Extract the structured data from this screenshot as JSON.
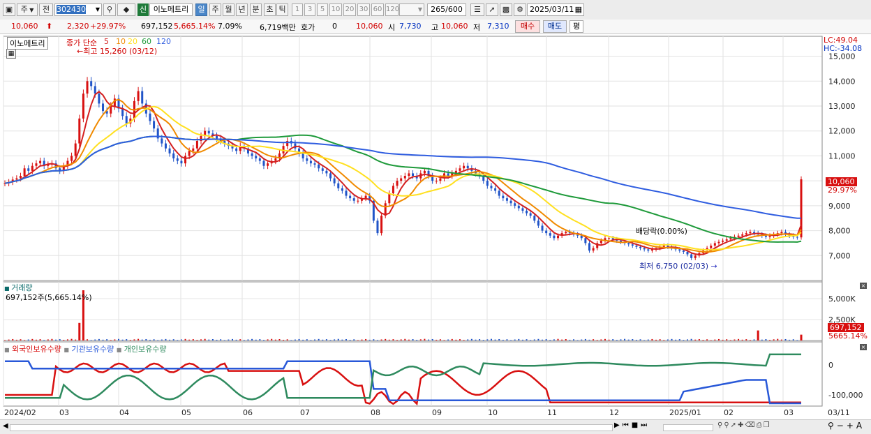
{
  "toolbar": {
    "type_label": "주",
    "prev_label": "전",
    "code": "302430",
    "credit_badge": "신",
    "stock_name": "이노메트리",
    "periods": [
      "일",
      "주",
      "월",
      "년",
      "분",
      "초",
      "틱"
    ],
    "active_period": "일",
    "intervals": [
      "1",
      "3",
      "5",
      "10",
      "20",
      "30",
      "60",
      "120"
    ],
    "count": "265",
    "count_max": "/600",
    "date": "2025/03/11"
  },
  "quote": {
    "price": "10,060",
    "change": "2,320",
    "change_pct": "+29.97%",
    "volume": "697,152",
    "volume_pct": "5,665.14%",
    "turnover": "7.09%",
    "amount": "6,719백만",
    "hoga_label": "호가",
    "hoga_value": "0",
    "ask": "10,060",
    "open_label": "시",
    "open": "7,730",
    "high_label": "고",
    "high": "10,060",
    "low_label": "저",
    "low": "7,310",
    "buy_label": "매수",
    "sell_label": "매도",
    "eval_label": "평"
  },
  "price_panel": {
    "title": "이노메트리",
    "legend_prefix": "종가 단순",
    "ma_periods": [
      "5",
      "10",
      "20",
      "60",
      "120"
    ],
    "ma_colors": [
      "#d42020",
      "#f08a00",
      "#ffe020",
      "#1e9a3a",
      "#2f5de0"
    ],
    "lc": "LC:49.04",
    "hc": "HC:-34.08",
    "high_note": "최고 15,260 (03/12)",
    "low_note": "최저 6,750 (02/03)",
    "dividend_note": "배당락(0.00%)",
    "current_tag": "10,060",
    "current_pct": "29.97%"
  },
  "volume_panel": {
    "title": "거래량",
    "value": "697,152주(5,665.14%)",
    "tag_value": "697,152",
    "tag_pct": "5665.14%"
  },
  "holdings_panel": {
    "series": [
      {
        "name": "외국인보유수량",
        "color": "#d81010"
      },
      {
        "name": "기관보유수량",
        "color": "#2858d8"
      },
      {
        "name": "개인보유수량",
        "color": "#2e8a5e"
      }
    ]
  },
  "x_axis": {
    "labels": [
      "2024/02",
      "03",
      "04",
      "05",
      "06",
      "07",
      "08",
      "09",
      "10",
      "11",
      "12",
      "2025/01",
      "02",
      "03"
    ],
    "right_label": "03/11"
  },
  "chart_data": [
    {
      "type": "candlestick",
      "title": "이노메트리",
      "y_ticks": [
        7000,
        8000,
        9000,
        10000,
        11000,
        12000,
        13000,
        14000,
        15000
      ],
      "ylim": [
        6000,
        15800
      ],
      "closes": [
        9900,
        9950,
        10050,
        10100,
        10200,
        10500,
        10400,
        10600,
        10700,
        10800,
        10600,
        10650,
        10700,
        10500,
        10400,
        10600,
        10800,
        11000,
        11500,
        12500,
        13500,
        14000,
        13800,
        13500,
        13100,
        12800,
        12700,
        13000,
        13300,
        12900,
        12600,
        12300,
        12500,
        13200,
        13600,
        13100,
        12700,
        12400,
        12100,
        11700,
        11500,
        11300,
        11100,
        10900,
        10800,
        10700,
        11000,
        11200,
        11300,
        11600,
        11800,
        12000,
        11900,
        11800,
        11700,
        11600,
        11500,
        11400,
        11300,
        11200,
        11400,
        11300,
        11100,
        11000,
        10900,
        10800,
        10600,
        10700,
        10800,
        10900,
        11100,
        11400,
        11600,
        11500,
        11300,
        11100,
        10900,
        10800,
        10700,
        10650,
        10500,
        10400,
        10300,
        10100,
        9900,
        9700,
        9600,
        9400,
        9300,
        9200,
        9200,
        9300,
        9400,
        9200,
        8400,
        7900,
        8600,
        9100,
        9500,
        9800,
        10000,
        10100,
        10200,
        10300,
        10200,
        10100,
        10300,
        10400,
        10200,
        10000,
        10000,
        10100,
        10300,
        10200,
        10300,
        10400,
        10500,
        10600,
        10500,
        10400,
        10300,
        10200,
        10000,
        9800,
        9700,
        9600,
        9400,
        9300,
        9200,
        9100,
        9000,
        8900,
        8800,
        8700,
        8600,
        8400,
        8200,
        8000,
        7900,
        7800,
        7700,
        7800,
        7900,
        7950,
        7900,
        7850,
        7800,
        7700,
        7500,
        7200,
        7300,
        7500,
        7600,
        7700,
        7700,
        7650,
        7600,
        7550,
        7500,
        7450,
        7400,
        7350,
        7300,
        7250,
        7200,
        7250,
        7300,
        7350,
        7400,
        7350,
        7300,
        7250,
        7200,
        7150,
        7050,
        6900,
        7000,
        7100,
        7200,
        7300,
        7400,
        7500,
        7550,
        7600,
        7650,
        7700,
        7750,
        7800,
        7850,
        7900,
        7950,
        7900,
        7850,
        7800,
        7750,
        7800,
        7850,
        7900,
        7950,
        7850,
        7800,
        7750,
        7730,
        10060
      ]
    },
    {
      "type": "bar",
      "title": "거래량",
      "y_ticks": [
        2500000,
        5000000
      ],
      "y_tick_labels": [
        "2,500K",
        "5,000K"
      ],
      "ylim": [
        0,
        7000000
      ],
      "spikes": [
        {
          "label": "2024/03 초",
          "value": 2100000
        },
        {
          "label": "2024/03 초",
          "value": 6000000
        },
        {
          "label": "2025/03",
          "value": 1200000
        },
        {
          "label": "2025/03/11",
          "value": 697152
        }
      ]
    },
    {
      "type": "line",
      "title": "외국인·기관·개인 보유수량",
      "y_ticks": [
        0,
        -100000
      ],
      "y_tick_labels": [
        "0",
        "-100,000"
      ],
      "series": [
        {
          "name": "외국인보유수량"
        },
        {
          "name": "기관보유수량"
        },
        {
          "name": "개인보유수량"
        }
      ]
    }
  ]
}
